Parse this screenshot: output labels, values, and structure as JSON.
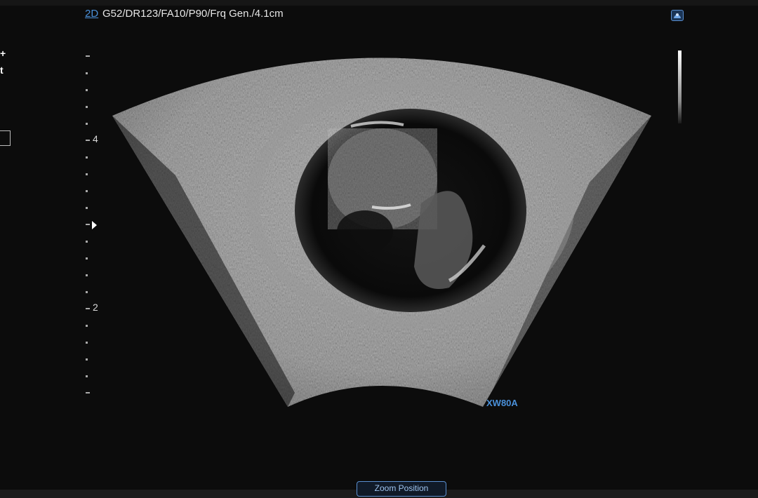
{
  "header": {
    "mode": "2D",
    "params": "G52/DR123/FA10/P90/Frq Gen./4.1cm"
  },
  "left_panel": {
    "plus": "+",
    "t": "t"
  },
  "depth_scale": {
    "labels": [
      "4",
      "2"
    ]
  },
  "probe": {
    "name": "XW80A"
  },
  "buttons": {
    "zoom_position": "Zoom Position"
  },
  "icons": {
    "probe_status": "probe-status-icon",
    "focus": "focus-marker-icon"
  }
}
